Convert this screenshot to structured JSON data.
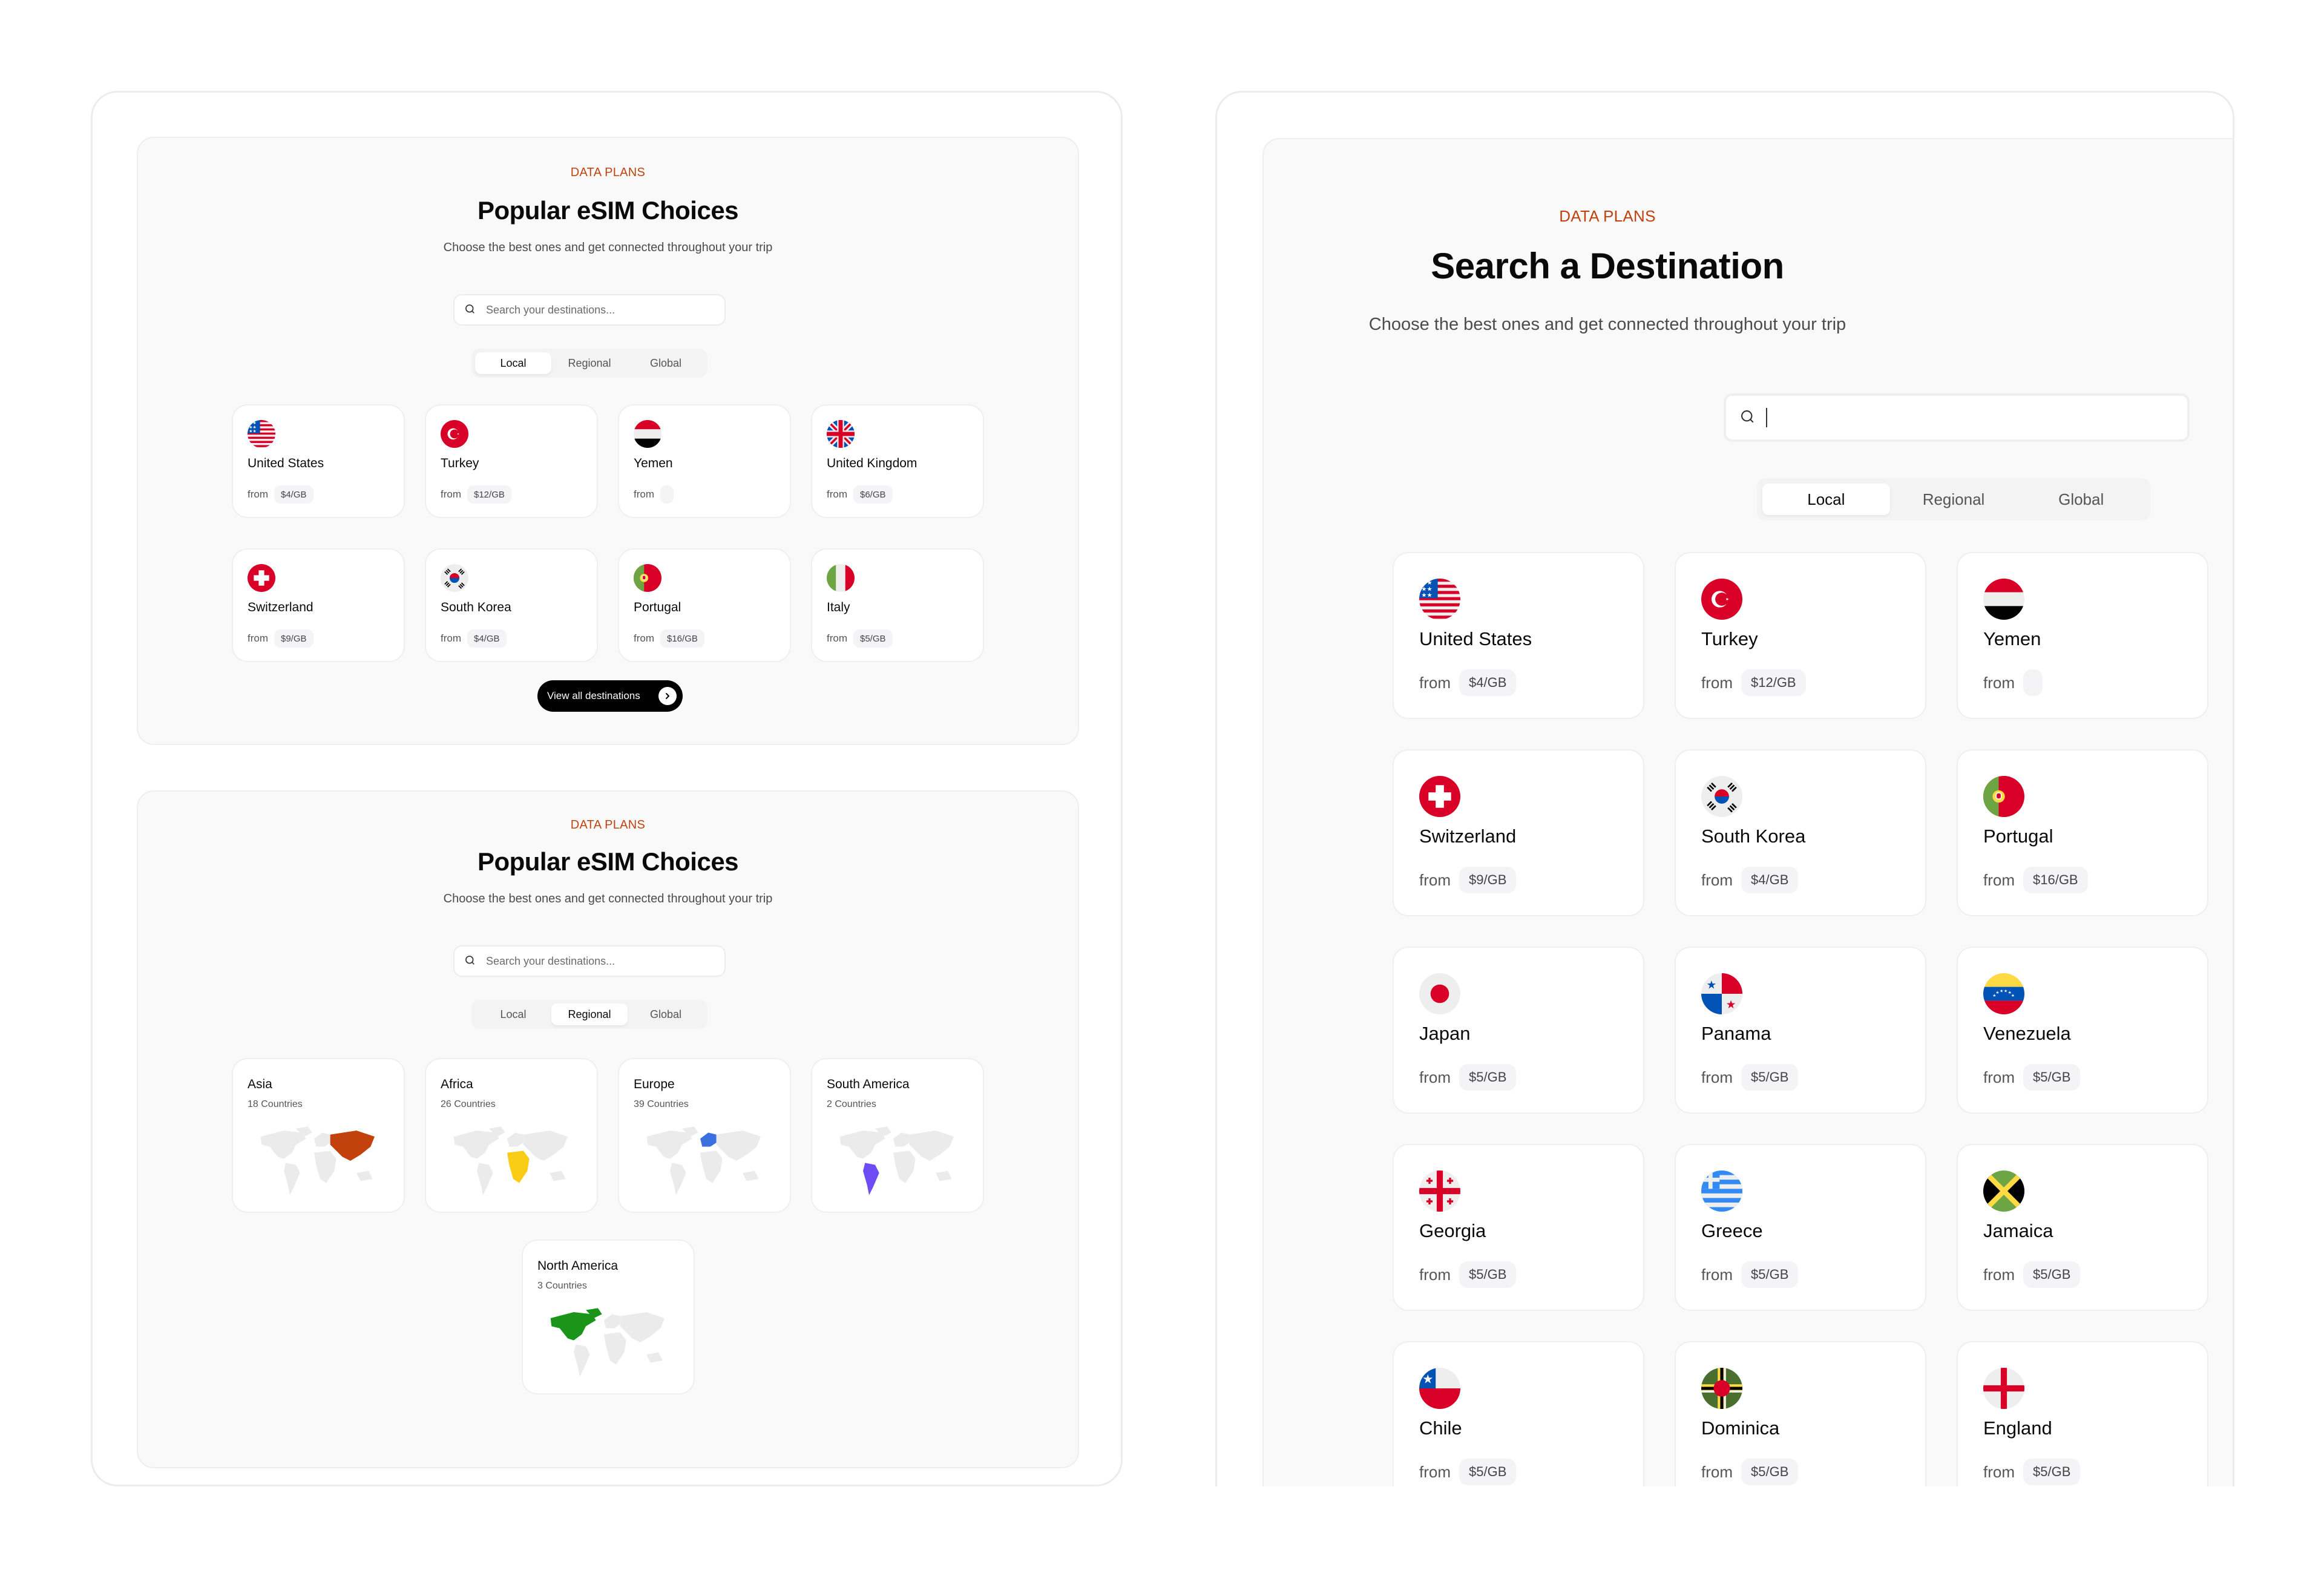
{
  "left_panel": {
    "local_section": {
      "eyebrow": "DATA PLANS",
      "title": "Popular eSIM Choices",
      "subtitle": "Choose the best ones and get connected throughout your trip",
      "search": {
        "placeholder": "Search your destinations...",
        "value": ""
      },
      "tabs": [
        {
          "label": "Local",
          "active": true
        },
        {
          "label": "Regional",
          "active": false
        },
        {
          "label": "Global",
          "active": false
        }
      ],
      "countries": [
        {
          "name": "United States",
          "flag": "us-flag-icon",
          "from_label": "from",
          "price": "$4/GB"
        },
        {
          "name": "Turkey",
          "flag": "turkey-flag-icon",
          "from_label": "from",
          "price": "$12/GB"
        },
        {
          "name": "Yemen",
          "flag": "yemen-flag-icon",
          "from_label": "from",
          "price": ""
        },
        {
          "name": "United Kingdom",
          "flag": "uk-flag-icon",
          "from_label": "from",
          "price": "$6/GB"
        },
        {
          "name": "Switzerland",
          "flag": "switzerland-flag-icon",
          "from_label": "from",
          "price": "$9/GB"
        },
        {
          "name": "South Korea",
          "flag": "south-korea-flag-icon",
          "from_label": "from",
          "price": "$4/GB"
        },
        {
          "name": "Portugal",
          "flag": "portugal-flag-icon",
          "from_label": "from",
          "price": "$16/GB"
        },
        {
          "name": "Italy",
          "flag": "italy-flag-icon",
          "from_label": "from",
          "price": "$5/GB"
        }
      ],
      "view_all_label": "View all destinations"
    },
    "regional_section": {
      "eyebrow": "DATA PLANS",
      "title": "Popular eSIM Choices",
      "subtitle": "Choose the best ones and get connected throughout your trip",
      "search": {
        "placeholder": "Search your destinations...",
        "value": ""
      },
      "tabs": [
        {
          "label": "Local",
          "active": false
        },
        {
          "label": "Regional",
          "active": true
        },
        {
          "label": "Global",
          "active": false
        }
      ],
      "regions": [
        {
          "name": "Asia",
          "count": "18 Countries",
          "highlight": "#c2410c"
        },
        {
          "name": "Africa",
          "count": "26 Countries",
          "highlight": "#facc15"
        },
        {
          "name": "Europe",
          "count": "39 Countries",
          "highlight": "#3b6fe0"
        },
        {
          "name": "South America",
          "count": "2 Countries",
          "highlight": "#6d4cf6"
        },
        {
          "name": "North America",
          "count": "3 Countries",
          "highlight": "#1a9419"
        }
      ]
    }
  },
  "right_panel": {
    "eyebrow": "DATA PLANS",
    "title": "Search a Destination",
    "subtitle": "Choose the best ones and get connected throughout your trip",
    "search": {
      "placeholder": "",
      "value": ""
    },
    "tabs": [
      {
        "label": "Local",
        "active": true
      },
      {
        "label": "Regional",
        "active": false
      },
      {
        "label": "Global",
        "active": false
      }
    ],
    "countries": [
      {
        "name": "United States",
        "flag": "us-flag-icon",
        "from_label": "from",
        "price": "$4/GB"
      },
      {
        "name": "Turkey",
        "flag": "turkey-flag-icon",
        "from_label": "from",
        "price": "$12/GB"
      },
      {
        "name": "Yemen",
        "flag": "yemen-flag-icon",
        "from_label": "from",
        "price": ""
      },
      {
        "name": "Switzerland",
        "flag": "switzerland-flag-icon",
        "from_label": "from",
        "price": "$9/GB"
      },
      {
        "name": "South Korea",
        "flag": "south-korea-flag-icon",
        "from_label": "from",
        "price": "$4/GB"
      },
      {
        "name": "Portugal",
        "flag": "portugal-flag-icon",
        "from_label": "from",
        "price": "$16/GB"
      },
      {
        "name": "Japan",
        "flag": "japan-flag-icon",
        "from_label": "from",
        "price": "$5/GB"
      },
      {
        "name": "Panama",
        "flag": "panama-flag-icon",
        "from_label": "from",
        "price": "$5/GB"
      },
      {
        "name": "Venezuela",
        "flag": "venezuela-flag-icon",
        "from_label": "from",
        "price": "$5/GB"
      },
      {
        "name": "Georgia",
        "flag": "georgia-flag-icon",
        "from_label": "from",
        "price": "$5/GB"
      },
      {
        "name": "Greece",
        "flag": "greece-flag-icon",
        "from_label": "from",
        "price": "$5/GB"
      },
      {
        "name": "Jamaica",
        "flag": "jamaica-flag-icon",
        "from_label": "from",
        "price": "$5/GB"
      },
      {
        "name": "Chile",
        "flag": "chile-flag-icon",
        "from_label": "from",
        "price": "$5/GB"
      },
      {
        "name": "Dominica",
        "flag": "dominica-flag-icon",
        "from_label": "from",
        "price": "$5/GB"
      },
      {
        "name": "England",
        "flag": "england-flag-icon",
        "from_label": "from",
        "price": "$5/GB"
      }
    ]
  },
  "colors": {
    "accent": "#c2410c",
    "section_bg": "#f9f9f9",
    "price_chip_bg": "#f4f4f6",
    "button_bg": "#000000"
  }
}
